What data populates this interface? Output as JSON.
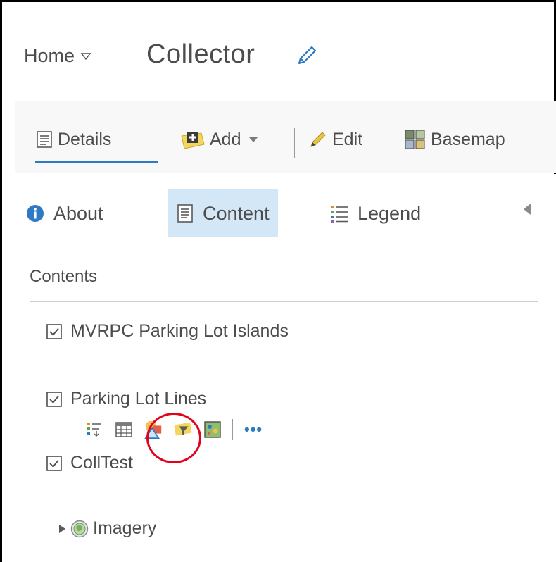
{
  "header": {
    "home_label": "Home",
    "map_title": "Collector"
  },
  "toolbar": {
    "details_label": "Details",
    "add_label": "Add",
    "edit_label": "Edit",
    "basemap_label": "Basemap"
  },
  "panel_tabs": {
    "about_label": "About",
    "content_label": "Content",
    "legend_label": "Legend"
  },
  "contents": {
    "heading": "Contents",
    "layers": [
      {
        "name": "MVRPC Parking Lot Islands",
        "checked": true
      },
      {
        "name": "Parking Lot Lines",
        "checked": true
      },
      {
        "name": "CollTest",
        "checked": true
      }
    ],
    "group_layer": {
      "name": "Imagery",
      "expanded": false
    }
  },
  "layer_tools": {
    "more_label": "•••"
  },
  "colors": {
    "accent": "#2e7bc4",
    "active_tab_bg": "#d4e7f7",
    "highlight_ring": "#e5001b",
    "text": "#4c4c4c"
  }
}
